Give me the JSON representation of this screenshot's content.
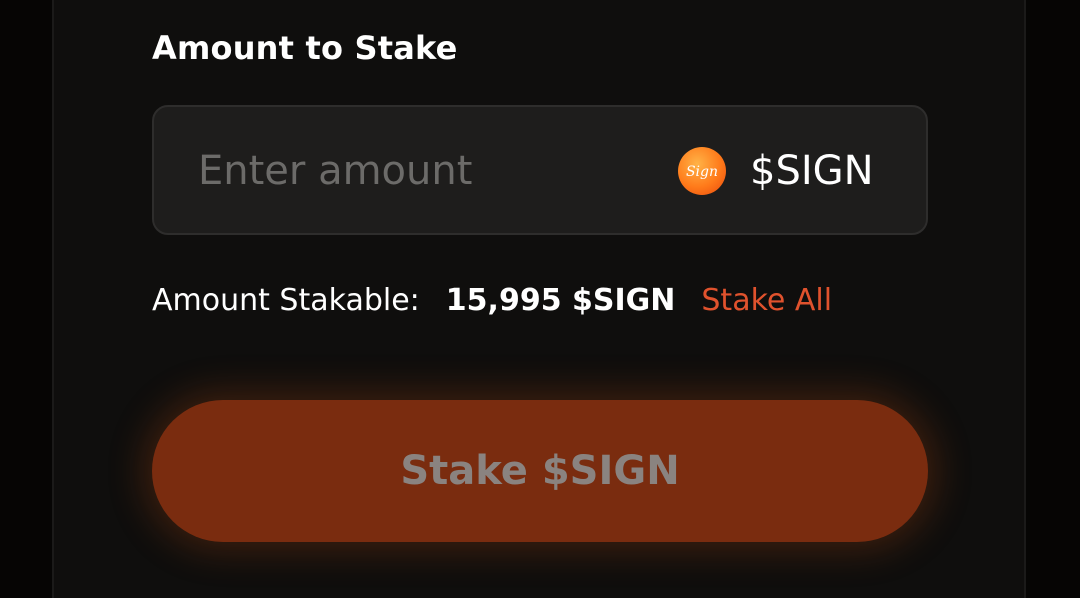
{
  "stake_form": {
    "title": "Amount to Stake",
    "amount_input": {
      "value": "",
      "placeholder": "Enter amount"
    },
    "token": {
      "symbol": "$SIGN",
      "logo_text": "Sign",
      "logo_icon": "sign-token-logo-icon",
      "logo_color": "#ff7a1a"
    },
    "stakable": {
      "label": "Amount Stakable:",
      "value": "15,995 $SIGN"
    },
    "stake_all_label": "Stake All",
    "submit_label": "Stake $SIGN"
  },
  "colors": {
    "background": "#060504",
    "panel": "#0f0e0d",
    "input_background": "#1e1d1c",
    "accent": "#e0522d",
    "button_background": "#7a2c0f",
    "button_text_disabled": "#8a8380"
  }
}
